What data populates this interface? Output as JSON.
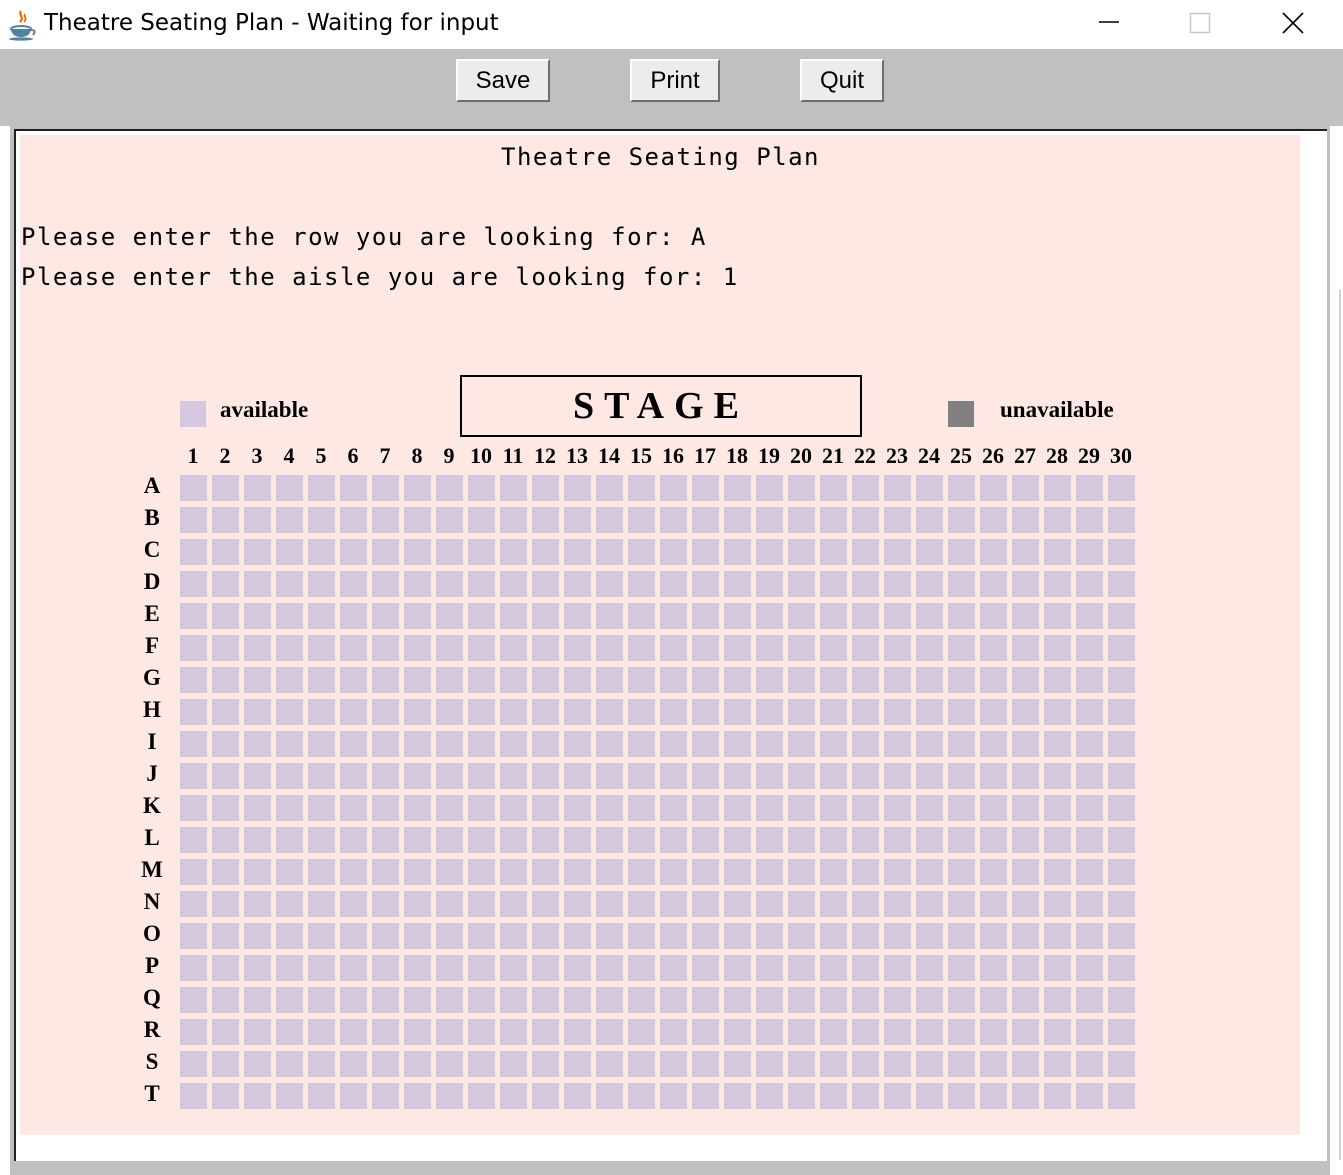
{
  "window": {
    "title": "Theatre Seating Plan - Waiting for input",
    "app_icon": "java-cup-icon",
    "controls": [
      "minimize-icon",
      "maximize-icon",
      "close-icon"
    ]
  },
  "toolbar": {
    "save_label": "Save",
    "print_label": "Print",
    "quit_label": "Quit"
  },
  "console": {
    "heading": "Theatre Seating Plan",
    "lines": [
      "Please enter the row you are looking for: A",
      "Please enter the aisle you are looking for: 1"
    ]
  },
  "plan": {
    "stage_label": "STAGE",
    "legend_available": "available",
    "legend_unavailable": "unavailable",
    "colors": {
      "available": "#d5c8de",
      "unavailable": "#808080",
      "background": "#fde8e4"
    },
    "columns": [
      "1",
      "2",
      "3",
      "4",
      "5",
      "6",
      "7",
      "8",
      "9",
      "10",
      "11",
      "12",
      "13",
      "14",
      "15",
      "16",
      "17",
      "18",
      "19",
      "20",
      "21",
      "22",
      "23",
      "24",
      "25",
      "26",
      "27",
      "28",
      "29",
      "30"
    ],
    "rows": [
      "A",
      "B",
      "C",
      "D",
      "E",
      "F",
      "G",
      "H",
      "I",
      "J",
      "K",
      "L",
      "M",
      "N",
      "O",
      "P",
      "Q",
      "R",
      "S",
      "T"
    ],
    "unavailable_seats": []
  }
}
